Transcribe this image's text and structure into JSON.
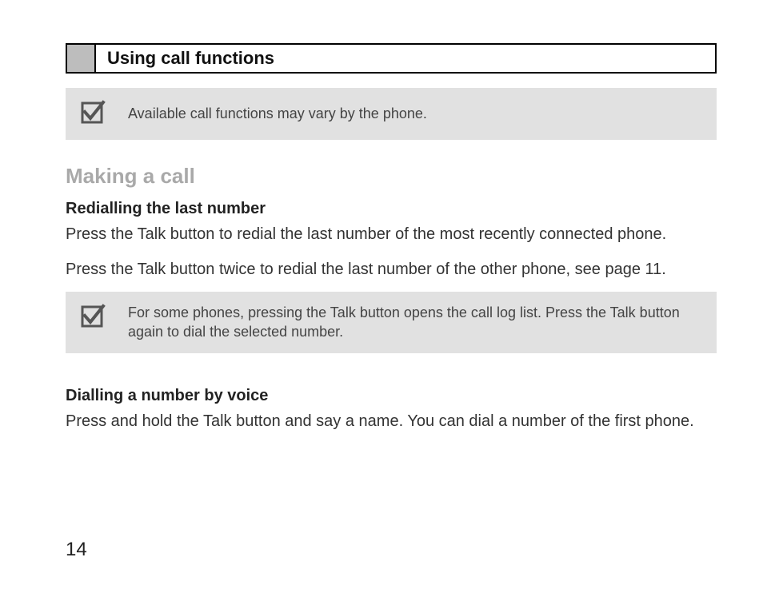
{
  "header": {
    "title": "Using call functions"
  },
  "note1": {
    "text": "Available call functions may vary by the phone."
  },
  "section1": {
    "heading": "Making a call",
    "sub1": {
      "title": "Redialling the last number",
      "para1": "Press the Talk button to redial the last number of the most recently connected phone.",
      "para2": "Press the Talk button twice to redial the last number of the other phone, see page 11."
    },
    "note2": {
      "text": "For some  phones, pressing the Talk button opens the call log list. Press the Talk button again to dial the selected number."
    },
    "sub2": {
      "title": "Dialling a number by voice",
      "para1": "Press and hold the Talk button and say a name. You can dial a number of the first phone."
    }
  },
  "pageNumber": "14"
}
